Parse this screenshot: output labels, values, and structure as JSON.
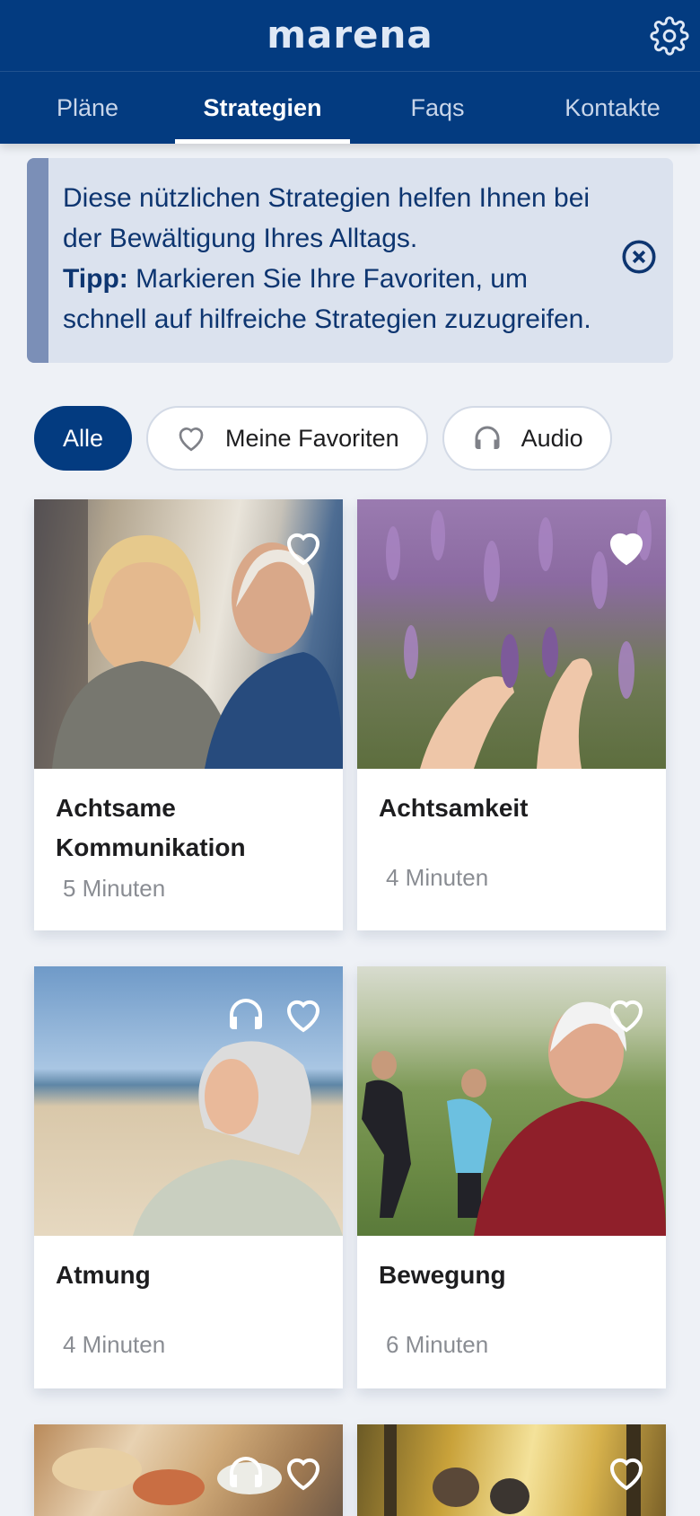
{
  "app": {
    "logo_text": "marena"
  },
  "tabs": [
    {
      "label": "Pläne"
    },
    {
      "label": "Strategien"
    },
    {
      "label": "Faqs"
    },
    {
      "label": "Kontakte"
    }
  ],
  "banner": {
    "line1": "Diese nützlichen Strategien helfen Ihnen bei der Bewältigung Ihres Alltags.",
    "tip_label": "Tipp:",
    "tip_text": " Markieren Sie Ihre Favoriten, um schnell auf hilfreiche Strategien zuzugreifen."
  },
  "filters": [
    {
      "label": "Alle"
    },
    {
      "label": "Meine Favoriten"
    },
    {
      "label": "Audio"
    }
  ],
  "cards": [
    {
      "title": "Achtsame Kommunikation",
      "duration": "5 Minuten",
      "favorite": false,
      "audio": false
    },
    {
      "title": "Achtsamkeit",
      "duration": "4 Minuten",
      "favorite": true,
      "audio": false
    },
    {
      "title": "Atmung",
      "duration": "4 Minuten",
      "favorite": false,
      "audio": true
    },
    {
      "title": "Bewegung",
      "duration": "6 Minuten",
      "favorite": false,
      "audio": false
    },
    {
      "favorite": false,
      "audio": true
    },
    {
      "favorite": false,
      "audio": false
    }
  ],
  "colors": {
    "primary": "#033b80",
    "banner_bg": "#dbe2ee",
    "banner_stripe": "#7b8fb7"
  }
}
